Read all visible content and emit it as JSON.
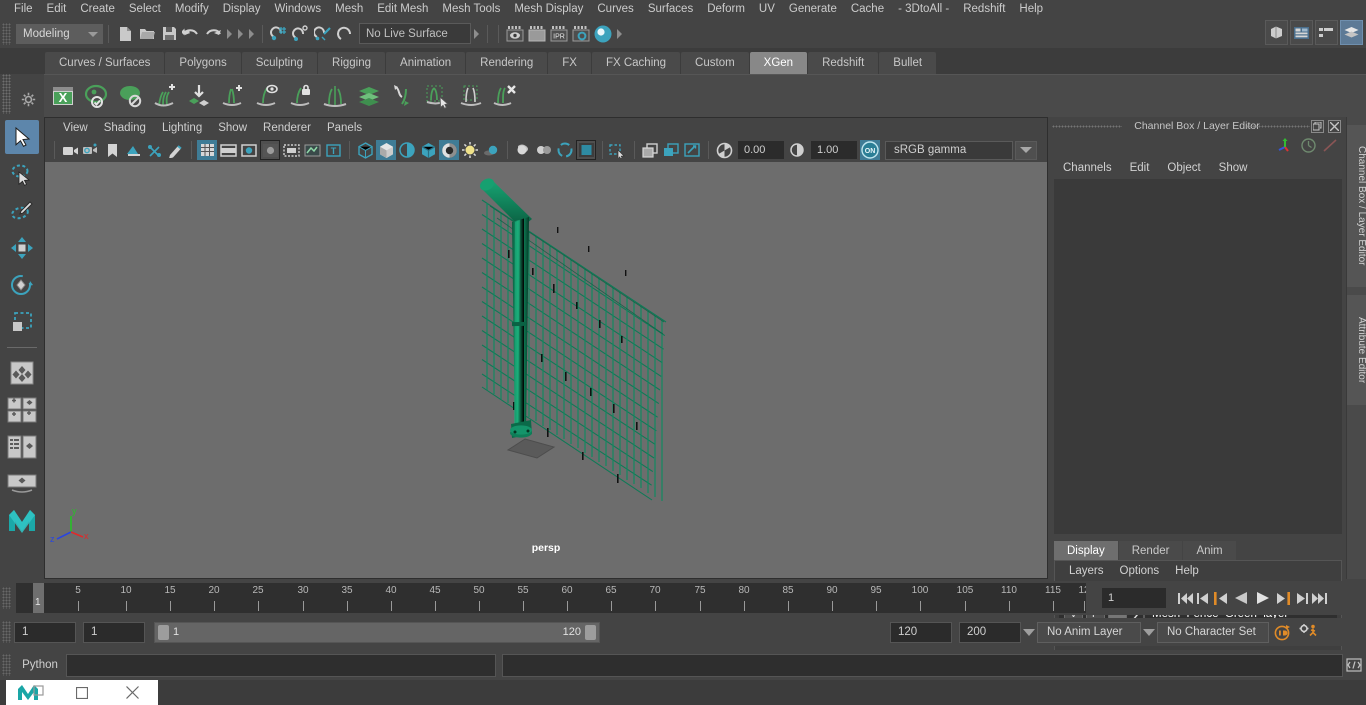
{
  "app": {
    "menus": [
      "File",
      "Edit",
      "Create",
      "Select",
      "Modify",
      "Display",
      "Windows",
      "Mesh",
      "Edit Mesh",
      "Mesh Tools",
      "Mesh Display",
      "Curves",
      "Surfaces",
      "Deform",
      "UV",
      "Generate",
      "Cache",
      "- 3DtoAll -",
      "Redshift",
      "Help"
    ]
  },
  "status_line": {
    "mode": "Modeling",
    "live_surface": "No Live Surface",
    "file_icons": [
      "new-scene-icon",
      "open-scene-icon",
      "save-scene-icon",
      "undo-icon",
      "redo-icon"
    ],
    "snap_icons": [
      "snap-to-grid-icon",
      "snap-to-curve-icon",
      "snap-to-point-icon",
      "snap-to-projected-center-icon",
      "make-live-icon"
    ],
    "render_icons": [
      "render-current-frame-icon",
      "render-sequence-icon",
      "ipr-render-icon",
      "render-settings-icon",
      "hypershade-icon"
    ],
    "sidebar_toggles": [
      "show-modeling-toolkit-icon",
      "show-attribute-editor-icon",
      "show-tool-settings-icon",
      "show-channel-box-icon"
    ]
  },
  "shelf": {
    "tabs": [
      "Curves / Surfaces",
      "Polygons",
      "Sculpting",
      "Rigging",
      "Animation",
      "Rendering",
      "FX",
      "FX Caching",
      "Custom",
      "XGen",
      "Redshift",
      "Bullet"
    ],
    "active_tab": "XGen",
    "items": [
      "xgen-editor-icon",
      "xgen-preview-icon",
      "xgen-render-icon",
      "xgen-add-groom-icon",
      "xgen-import-icon",
      "xgen-add-guide-icon",
      "xgen-guide-visibility-icon",
      "xgen-lock-guide-icon",
      "xgen-mirror-guide-icon",
      "xgen-density-icon",
      "xgen-region-icon",
      "xgen-select-guides-icon",
      "xgen-clump-icon",
      "xgen-delete-guide-icon"
    ]
  },
  "viewport": {
    "menus": [
      "View",
      "Shading",
      "Lighting",
      "Show",
      "Renderer",
      "Panels"
    ],
    "camera_label": "persp",
    "exposure": "0.00",
    "gamma_value": "1.00",
    "color_management": "sRGB gamma",
    "color_management_on": "ON",
    "axes": [
      "y",
      "z",
      "x"
    ],
    "toolbar_icons": [
      "select-camera-icon",
      "camera-attributes-icon",
      "bookmarks-icon",
      "image-plane-icon",
      "two-d-pan-zoom-icon",
      "grease-pencil-icon",
      "grid-toggle-icon",
      "film-gate-icon",
      "resolution-gate-icon",
      "gate-mask-icon",
      "film-origin-icon",
      "xray-joints-icon",
      "texture-toggle-icon",
      "wireframe-shading-icon",
      "smooth-shade-all-icon",
      "shaded-wireframe-icon",
      "hardware-texturing-icon",
      "use-all-lights-icon",
      "shadows-icon",
      "screen-space-ao-icon",
      "motion-blur-icon",
      "multisample-icon",
      "depth-of-field-icon",
      "isolate-select-icon",
      "xray-icon",
      "xray-active-components-icon",
      "exposure-icon",
      "gamma-icon",
      "color-management-icon"
    ]
  },
  "toolbox": {
    "tools": [
      {
        "name": "select-tool",
        "selected": true
      },
      {
        "name": "lasso-select-tool",
        "selected": false
      },
      {
        "name": "paint-select-tool",
        "selected": false
      },
      {
        "name": "move-tool",
        "selected": false
      },
      {
        "name": "rotate-tool",
        "selected": false
      },
      {
        "name": "scale-tool",
        "selected": false
      },
      {
        "name": "last-tool-used",
        "selected": false
      },
      {
        "name": "single-perspective-view-layout",
        "selected": false
      },
      {
        "name": "four-view-layout",
        "selected": false
      },
      {
        "name": "outliner-persp-layout",
        "selected": false
      },
      {
        "name": "persp-graph-layout",
        "selected": false
      },
      {
        "name": "maya-logo-icon",
        "selected": false
      }
    ]
  },
  "right_panel": {
    "title": "Channel Box / Layer Editor",
    "window_buttons": [
      "restore-icon",
      "close-icon"
    ],
    "header_icons": [
      "move-axis-icon",
      "clock-icon",
      "slash-icon"
    ],
    "channel_menus": [
      "Channels",
      "Edit",
      "Object",
      "Show"
    ],
    "layer_tabs": [
      "Display",
      "Render",
      "Anim"
    ],
    "active_layer_tab": "Display",
    "layer_menus": [
      "Layers",
      "Options",
      "Help"
    ],
    "layer_buttons": [
      "move-layer-up-icon",
      "move-layer-down-icon",
      "create-new-layer-icon",
      "create-layer-from-selected-icon"
    ],
    "layers": [
      {
        "visibility": "V",
        "playback": "P",
        "shading": "",
        "color_swatch": "#bdbdbd",
        "name": "Mesh_Fence_Green_layer"
      }
    ],
    "side_tabs": [
      "Channel Box / Layer Editor",
      "Attribute Editor"
    ]
  },
  "timeline": {
    "ticks": [
      "5",
      "10",
      "15",
      "20",
      "25",
      "30",
      "35",
      "40",
      "45",
      "50",
      "55",
      "60",
      "65",
      "70",
      "75",
      "80",
      "85",
      "90",
      "95",
      "100",
      "105",
      "110",
      "115",
      "12"
    ],
    "current_frame_marker": "1",
    "current_frame_field": "1",
    "playback_buttons": [
      "go-to-start-icon",
      "step-back-keyframe-icon",
      "step-back-frame-icon",
      "play-backwards-icon",
      "play-forwards-icon",
      "step-forward-frame-icon",
      "step-forward-keyframe-icon",
      "go-to-end-icon"
    ]
  },
  "range_slider": {
    "anim_start": "1",
    "range_start": "1",
    "bar_start": "1",
    "bar_end": "120",
    "range_end": "120",
    "anim_end": "200",
    "anim_layer": "No Anim Layer",
    "character_set": "No Character Set",
    "right_icons": [
      "auto-keyframe-toggle-icon",
      "animation-preferences-icon"
    ]
  },
  "command_line": {
    "language": "Python",
    "input_value": "",
    "result_value": "",
    "help_icon": "script-editor-icon"
  },
  "taskbar": {
    "items": [
      "maya-app-icon",
      "restore-window-icon",
      "close-window-icon"
    ]
  },
  "colors": {
    "accent_teal": "#3ca3bd",
    "select_blue": "#5d86ab",
    "shelf_green": "#5aa360",
    "model_green": "#0f7a55",
    "viewport_bg": "#6d6d6d",
    "panel_bg": "#444444",
    "orange": "#d97b26"
  }
}
